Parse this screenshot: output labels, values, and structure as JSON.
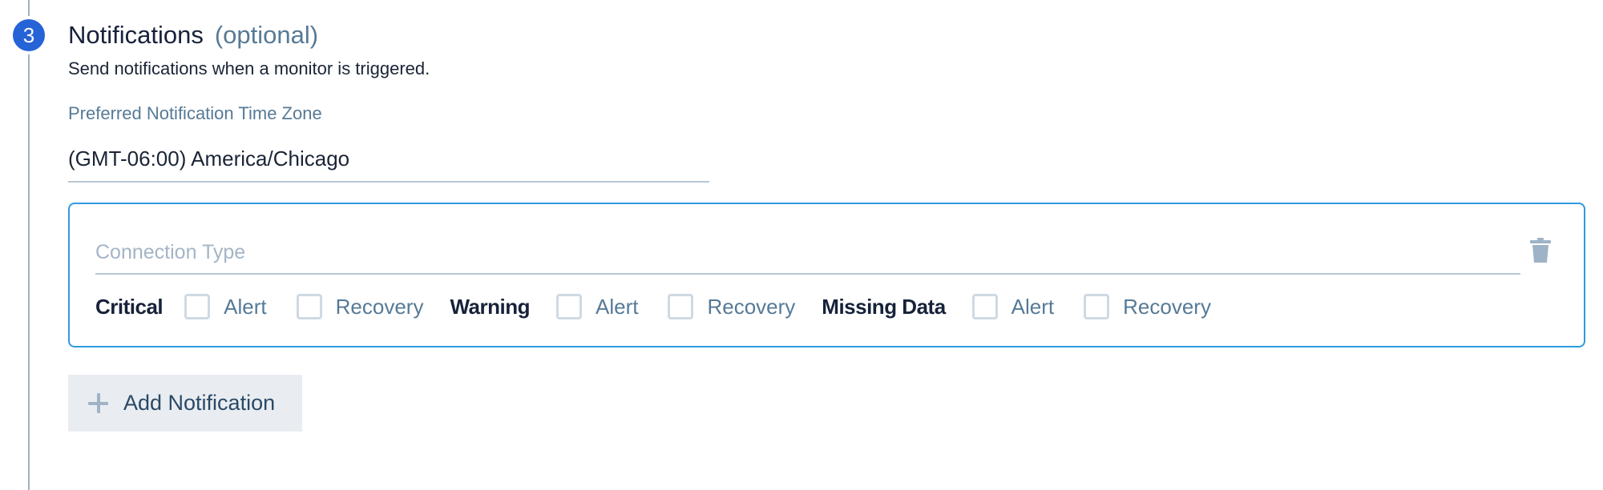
{
  "step": {
    "number": "3",
    "title": "Notifications",
    "optional_label": "(optional)",
    "description": "Send notifications when a monitor is triggered."
  },
  "timezone": {
    "label": "Preferred Notification Time Zone",
    "value": "(GMT-06:00) America/Chicago"
  },
  "notification": {
    "connection_type_placeholder": "Connection Type",
    "delete_icon": "trash-icon",
    "groups": [
      {
        "label": "Critical",
        "options": [
          {
            "label": "Alert",
            "checked": false
          },
          {
            "label": "Recovery",
            "checked": false
          }
        ]
      },
      {
        "label": "Warning",
        "options": [
          {
            "label": "Alert",
            "checked": false
          },
          {
            "label": "Recovery",
            "checked": false
          }
        ]
      },
      {
        "label": "Missing Data",
        "options": [
          {
            "label": "Alert",
            "checked": false
          },
          {
            "label": "Recovery",
            "checked": false
          }
        ]
      }
    ]
  },
  "add_button": {
    "icon": "plus-icon",
    "label": "Add Notification"
  },
  "colors": {
    "step_accent": "#2563d6",
    "box_border": "#2f9be0",
    "muted_text": "#567a96"
  }
}
